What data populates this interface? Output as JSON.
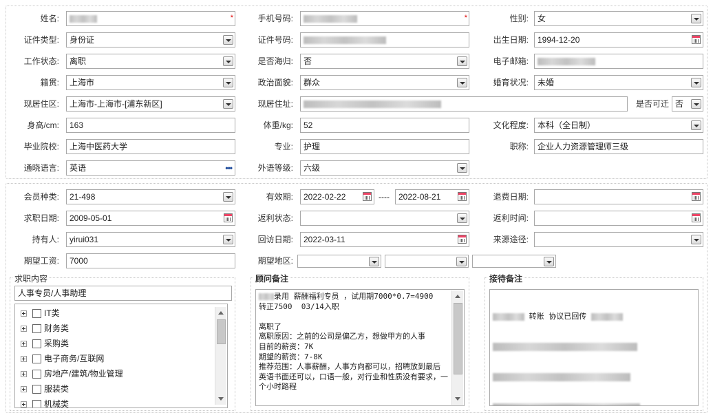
{
  "row1": {
    "name_label": "姓名:",
    "phone_label": "手机号码:",
    "gender_label": "性别:",
    "gender_value": "女",
    "required_mark": "*"
  },
  "row2": {
    "id_type_label": "证件类型:",
    "id_type_value": "身份证",
    "id_no_label": "证件号码:",
    "birth_label": "出生日期:",
    "birth_value": "1994-12-20"
  },
  "row3": {
    "work_label": "工作状态:",
    "work_value": "离职",
    "returnee_label": "是否海归:",
    "returnee_value": "否",
    "email_label": "电子邮箱:"
  },
  "row4": {
    "origin_label": "籍贯:",
    "origin_value": "上海市",
    "political_label": "政治面貌:",
    "political_value": "群众",
    "marital_label": "婚育状况:",
    "marital_value": "未婚"
  },
  "row5": {
    "residence_label": "现居住区:",
    "residence_value": "上海市-上海市-[浦东新区]",
    "address_label": "现居住址:",
    "relocate_label": "是否可迁",
    "relocate_value": "否"
  },
  "row6": {
    "height_label": "身高/cm:",
    "height_value": "163",
    "weight_label": "体重/kg:",
    "weight_value": "52",
    "edu_label": "文化程度:",
    "edu_value": "本科（全日制）"
  },
  "row7": {
    "school_label": "毕业院校:",
    "school_value": "上海中医药大学",
    "major_label": "专业:",
    "major_value": "护理",
    "title_label": "职称:",
    "title_value": "企业人力资源管理师三级"
  },
  "row8": {
    "lang_label": "通晓语言:",
    "lang_value": "英语",
    "lang_dots": "•••",
    "foreign_label": "外语等级:",
    "foreign_value": "六级"
  },
  "row9": {
    "member_label": "会员种类:",
    "member_value": "21-498",
    "valid_label": "有效期:",
    "valid_from": "2022-02-22",
    "valid_sep": "----",
    "valid_to": "2022-08-21",
    "refund_label": "退费日期:"
  },
  "row10": {
    "job_date_label": "求职日期:",
    "job_date_value": "2009-05-01",
    "rebate_status_label": "返利状态:",
    "rebate_time_label": "返利时间:"
  },
  "row11": {
    "holder_label": "持有人:",
    "holder_value": "yirui031",
    "visit_label": "回访日期:",
    "visit_value": "2022-03-11",
    "source_label": "来源途径:"
  },
  "row12": {
    "salary_label": "期望工资:",
    "salary_value": "7000",
    "region_label": "期望地区:"
  },
  "job_box": {
    "title": "求职内容",
    "selected": "人事专员/人事助理",
    "items": [
      "IT类",
      "财务类",
      "采购类",
      "电子商务/互联网",
      "房地产/建筑/物业管理",
      "服装类",
      "机械类"
    ]
  },
  "advisor_box": {
    "title": "顾问备注",
    "text": "录用 薪酬福利专员 ，试用期7000*0.7=4900\n转正7500  03/14入职\n\n离职了\n离职原因：之前的公司是偏乙方，想做甲方的人事\n目前的薪资：7K\n期望的薪资：7-8K\n推荐范围：人事薪酬，人事方向都可以，招聘放到最后\n英语书面还可以，口语一般，对行业和性质没有要求，一个小时路程"
  },
  "reception_box": {
    "title": "接待备注",
    "line1_a": "转账",
    "line1_b": "协议已回传"
  }
}
